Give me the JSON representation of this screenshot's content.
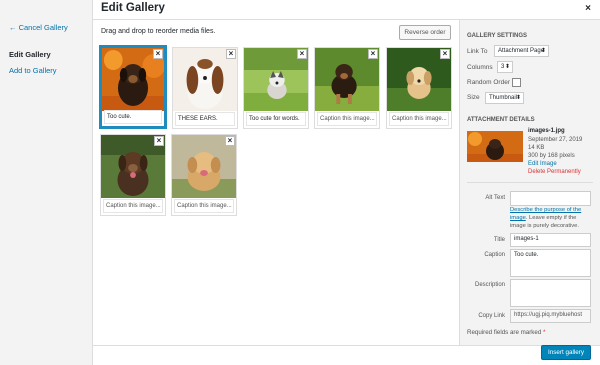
{
  "menu": {
    "cancel": "← Cancel Gallery",
    "edit": "Edit Gallery",
    "add": "Add to Gallery"
  },
  "title": "Edit Gallery",
  "close": "×",
  "toolbar": {
    "hint": "Drag and drop to reorder media files.",
    "reverse": "Reverse order"
  },
  "items": [
    {
      "caption": "Too cute."
    },
    {
      "caption": "THESE EARS."
    },
    {
      "caption": "Too cute for words."
    },
    {
      "caption": "Caption this image..."
    },
    {
      "caption": "Caption this image..."
    },
    {
      "caption": "Caption this image..."
    },
    {
      "caption": "Caption this image..."
    }
  ],
  "gallery_settings": {
    "heading": "GALLERY SETTINGS",
    "link_to_label": "Link To",
    "link_to_value": "Attachment Page",
    "columns_label": "Columns",
    "columns_value": "3",
    "random_label": "Random Order",
    "size_label": "Size",
    "size_value": "Thumbnail"
  },
  "attachment": {
    "heading": "ATTACHMENT DETAILS",
    "filename": "images-1.jpg",
    "date": "September 27, 2019",
    "filesize": "14 KB",
    "dimensions": "300 by 168 pixels",
    "edit_link": "Edit Image",
    "delete_link": "Delete Permanently",
    "alt_label": "Alt Text",
    "alt_value": "",
    "alt_help_link": "Describe the purpose of the image",
    "alt_help_rest": ". Leave empty if the image is purely decorative.",
    "title_label": "Title",
    "title_value": "images-1",
    "caption_label": "Caption",
    "caption_value": "Too cute.",
    "description_label": "Description",
    "description_value": "",
    "copy_link_label": "Copy Link",
    "copy_link_value": "https://ugj.piq.mybluehost",
    "required_note": "Required fields are marked",
    "required_star": "*"
  },
  "insert_button": "Insert gallery",
  "colors": {
    "accent": "#0073aa",
    "button": "#0085ba",
    "danger": "#dc3232",
    "selected": "#1e8cbe"
  }
}
